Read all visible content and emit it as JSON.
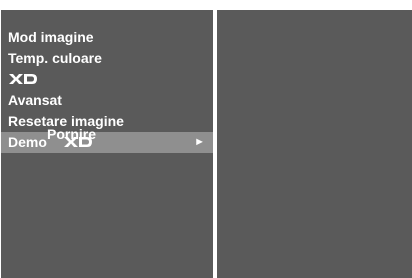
{
  "menu": {
    "items": [
      {
        "label": "Mod imagine"
      },
      {
        "label": "Temp. culoare"
      },
      {
        "label": "",
        "logo": "XD"
      },
      {
        "label": "Avansat"
      },
      {
        "label": "Resetare imagine"
      },
      {
        "label": "Demo",
        "logo": "XD",
        "selected": true,
        "arrow": "►"
      }
    ]
  },
  "submenu": {
    "label": "Pornire"
  },
  "colors": {
    "panel": "#5a5a5a",
    "selected": "#8f8f8f",
    "text": "#ffffff"
  }
}
